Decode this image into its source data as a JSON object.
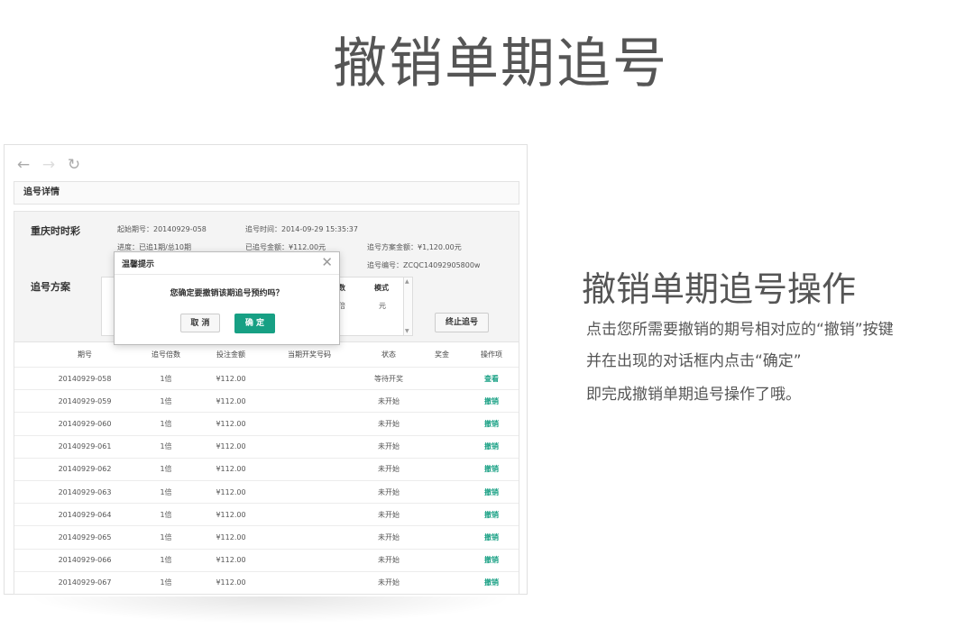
{
  "page": {
    "title": "撤销单期追号",
    "right_title": "撤销单期追号操作",
    "right_lines": [
      "点击您所需要撤销的期号相对应的“撤销”按键",
      "并在出现的对话框内点击“确定”",
      "即完成撤销单期追号操作了哦。"
    ]
  },
  "nav": {
    "back_icon": "←",
    "forward_icon": "→",
    "refresh_icon": "↻"
  },
  "breadcrumb": "追号详情",
  "detail": {
    "lottery": "重庆时时彩",
    "plan_label": "追号方案",
    "start_issue": "起始期号：20140929-058",
    "chase_time": "追号时间：2014-09-29 15:35:37",
    "progress": "进度：已追1期/总10期",
    "chased_amount": "已追号金额：¥112.00元",
    "plan_amount": "追号方案金额：¥1,120.00元",
    "chase_no": "追号编号：ZCQC14092905800w",
    "plan_headers": [
      "数",
      "模式"
    ],
    "plan_values": [
      "倍",
      "元"
    ],
    "stop_button": "终止追号"
  },
  "table": {
    "headers": [
      "期号",
      "追号倍数",
      "投注金额",
      "当期开奖号码",
      "状态",
      "奖金",
      "操作项"
    ],
    "rows": [
      {
        "issue": "20140929-058",
        "multiple": "1倍",
        "amount": "¥112.00",
        "result": "",
        "status": "等待开奖",
        "prize": "",
        "action": "查看"
      },
      {
        "issue": "20140929-059",
        "multiple": "1倍",
        "amount": "¥112.00",
        "result": "",
        "status": "未开始",
        "prize": "",
        "action": "撤销"
      },
      {
        "issue": "20140929-060",
        "multiple": "1倍",
        "amount": "¥112.00",
        "result": "",
        "status": "未开始",
        "prize": "",
        "action": "撤销"
      },
      {
        "issue": "20140929-061",
        "multiple": "1倍",
        "amount": "¥112.00",
        "result": "",
        "status": "未开始",
        "prize": "",
        "action": "撤销"
      },
      {
        "issue": "20140929-062",
        "multiple": "1倍",
        "amount": "¥112.00",
        "result": "",
        "status": "未开始",
        "prize": "",
        "action": "撤销"
      },
      {
        "issue": "20140929-063",
        "multiple": "1倍",
        "amount": "¥112.00",
        "result": "",
        "status": "未开始",
        "prize": "",
        "action": "撤销"
      },
      {
        "issue": "20140929-064",
        "multiple": "1倍",
        "amount": "¥112.00",
        "result": "",
        "status": "未开始",
        "prize": "",
        "action": "撤销"
      },
      {
        "issue": "20140929-065",
        "multiple": "1倍",
        "amount": "¥112.00",
        "result": "",
        "status": "未开始",
        "prize": "",
        "action": "撤销"
      },
      {
        "issue": "20140929-066",
        "multiple": "1倍",
        "amount": "¥112.00",
        "result": "",
        "status": "未开始",
        "prize": "",
        "action": "撤销"
      },
      {
        "issue": "20140929-067",
        "multiple": "1倍",
        "amount": "¥112.00",
        "result": "",
        "status": "未开始",
        "prize": "",
        "action": "撤销"
      }
    ]
  },
  "dialog": {
    "title": "温馨提示",
    "close_icon": "✕",
    "message": "您确定要撤销该期追号预约吗？",
    "cancel": "取 消",
    "ok": "确 定"
  },
  "colors": {
    "accent": "#17a084",
    "action_link": "#1aa185"
  }
}
